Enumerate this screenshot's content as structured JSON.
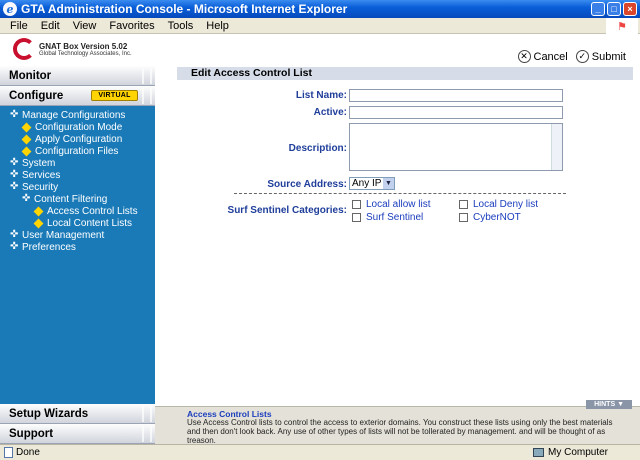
{
  "window": {
    "title": "GTA Administration Console - Microsoft Internet Explorer"
  },
  "menu": [
    "File",
    "Edit",
    "View",
    "Favorites",
    "Tools",
    "Help"
  ],
  "header": {
    "logo_line1": "GNAT Box Version 5.02",
    "logo_line2": "Global Technology Associates, Inc.",
    "cancel_label": "Cancel",
    "submit_label": "Submit"
  },
  "sidebar": {
    "monitor": "Monitor",
    "configure": "Configure",
    "virtual_badge": "VIRTUAL",
    "tree": [
      {
        "label": "Manage Configurations",
        "level": 0,
        "icon": "cross"
      },
      {
        "label": "Configuration Mode",
        "level": 1,
        "icon": "diamond"
      },
      {
        "label": "Apply Configuration",
        "level": 1,
        "icon": "diamond"
      },
      {
        "label": "Configuration Files",
        "level": 1,
        "icon": "diamond"
      },
      {
        "label": "System",
        "level": 0,
        "icon": "cross"
      },
      {
        "label": "Services",
        "level": 0,
        "icon": "cross"
      },
      {
        "label": "Security",
        "level": 0,
        "icon": "cross"
      },
      {
        "label": "Content Filtering",
        "level": 1,
        "icon": "cross"
      },
      {
        "label": "Access Control Lists",
        "level": 2,
        "icon": "diamond"
      },
      {
        "label": "Local Content Lists",
        "level": 2,
        "icon": "diamond"
      },
      {
        "label": "User Management",
        "level": 0,
        "icon": "cross"
      },
      {
        "label": "Preferences",
        "level": 0,
        "icon": "cross"
      }
    ],
    "setup_wizards": "Setup Wizards",
    "support": "Support"
  },
  "form": {
    "title": "Edit Access Control List",
    "list_name_label": "List Name:",
    "active_label": "Active:",
    "description_label": "Description:",
    "source_address_label": "Source Address:",
    "source_address_value": "Any IP",
    "surf_sentinel_label": "Surf Sentinel Categories:",
    "categories": [
      "Local allow list",
      "Local Deny list",
      "Surf Sentinel",
      "CyberNOT"
    ]
  },
  "help": {
    "hints_label": "HINTS",
    "title": "Access Control Lists",
    "text": "Use Access Control lists to control the access to exterior domains. You construct these lists using only the best materials and then don't look back. Any use of other types of lists will not be tollerated by management. and will be thought of as treason."
  },
  "status": {
    "left": "Done",
    "zone": "My Computer"
  }
}
